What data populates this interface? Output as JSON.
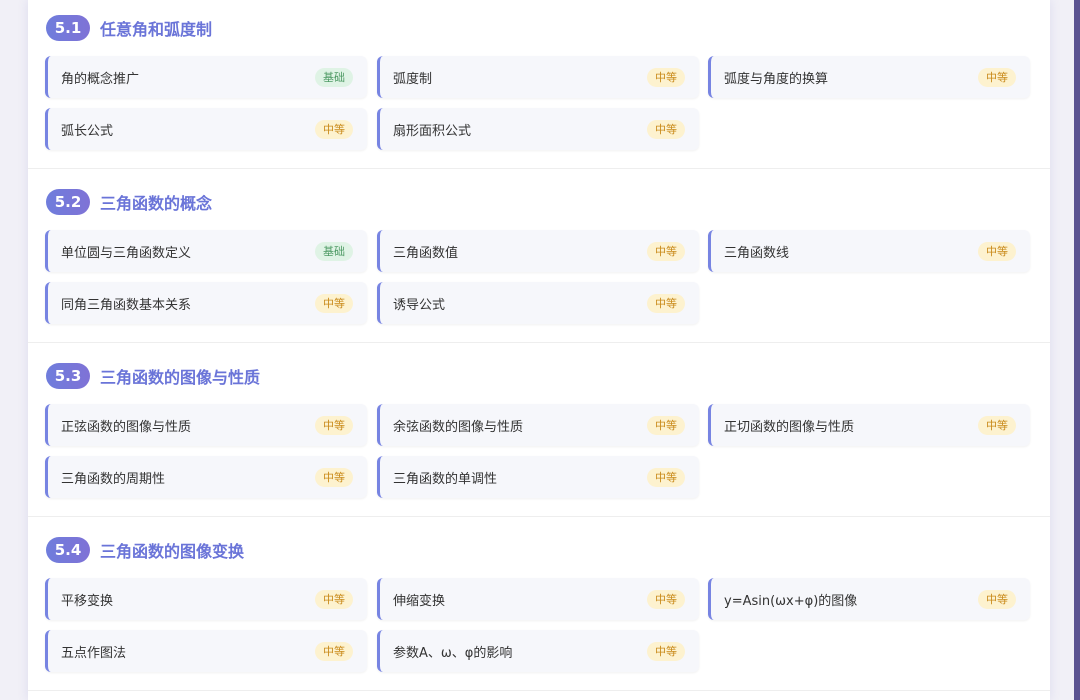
{
  "sections": [
    {
      "number": "5.1",
      "title": "任意角和弧度制",
      "items": [
        {
          "label": "角的概念推广",
          "level": "基础",
          "kind": "basic"
        },
        {
          "label": "弧度制",
          "level": "中等",
          "kind": "medium"
        },
        {
          "label": "弧度与角度的换算",
          "level": "中等",
          "kind": "medium"
        },
        {
          "label": "弧长公式",
          "level": "中等",
          "kind": "medium"
        },
        {
          "label": "扇形面积公式",
          "level": "中等",
          "kind": "medium"
        }
      ]
    },
    {
      "number": "5.2",
      "title": "三角函数的概念",
      "items": [
        {
          "label": "单位圆与三角函数定义",
          "level": "基础",
          "kind": "basic"
        },
        {
          "label": "三角函数值",
          "level": "中等",
          "kind": "medium"
        },
        {
          "label": "三角函数线",
          "level": "中等",
          "kind": "medium"
        },
        {
          "label": "同角三角函数基本关系",
          "level": "中等",
          "kind": "medium"
        },
        {
          "label": "诱导公式",
          "level": "中等",
          "kind": "medium"
        }
      ]
    },
    {
      "number": "5.3",
      "title": "三角函数的图像与性质",
      "items": [
        {
          "label": "正弦函数的图像与性质",
          "level": "中等",
          "kind": "medium"
        },
        {
          "label": "余弦函数的图像与性质",
          "level": "中等",
          "kind": "medium"
        },
        {
          "label": "正切函数的图像与性质",
          "level": "中等",
          "kind": "medium"
        },
        {
          "label": "三角函数的周期性",
          "level": "中等",
          "kind": "medium"
        },
        {
          "label": "三角函数的单调性",
          "level": "中等",
          "kind": "medium"
        }
      ]
    },
    {
      "number": "5.4",
      "title": "三角函数的图像变换",
      "items": [
        {
          "label": "平移变换",
          "level": "中等",
          "kind": "medium"
        },
        {
          "label": "伸缩变换",
          "level": "中等",
          "kind": "medium"
        },
        {
          "label": "y=Asin(ωx+φ)的图像",
          "level": "中等",
          "kind": "medium"
        },
        {
          "label": "五点作图法",
          "level": "中等",
          "kind": "medium"
        },
        {
          "label": "参数A、ω、φ的影响",
          "level": "中等",
          "kind": "medium"
        }
      ]
    }
  ],
  "colors": {
    "accent": "#6a74d8",
    "card_border": "#7784e2",
    "badge_basic_bg": "#dff3e5",
    "badge_basic_text": "#4e9a64",
    "badge_medium_bg": "#fdf2cf",
    "badge_medium_text": "#c98a1a"
  }
}
